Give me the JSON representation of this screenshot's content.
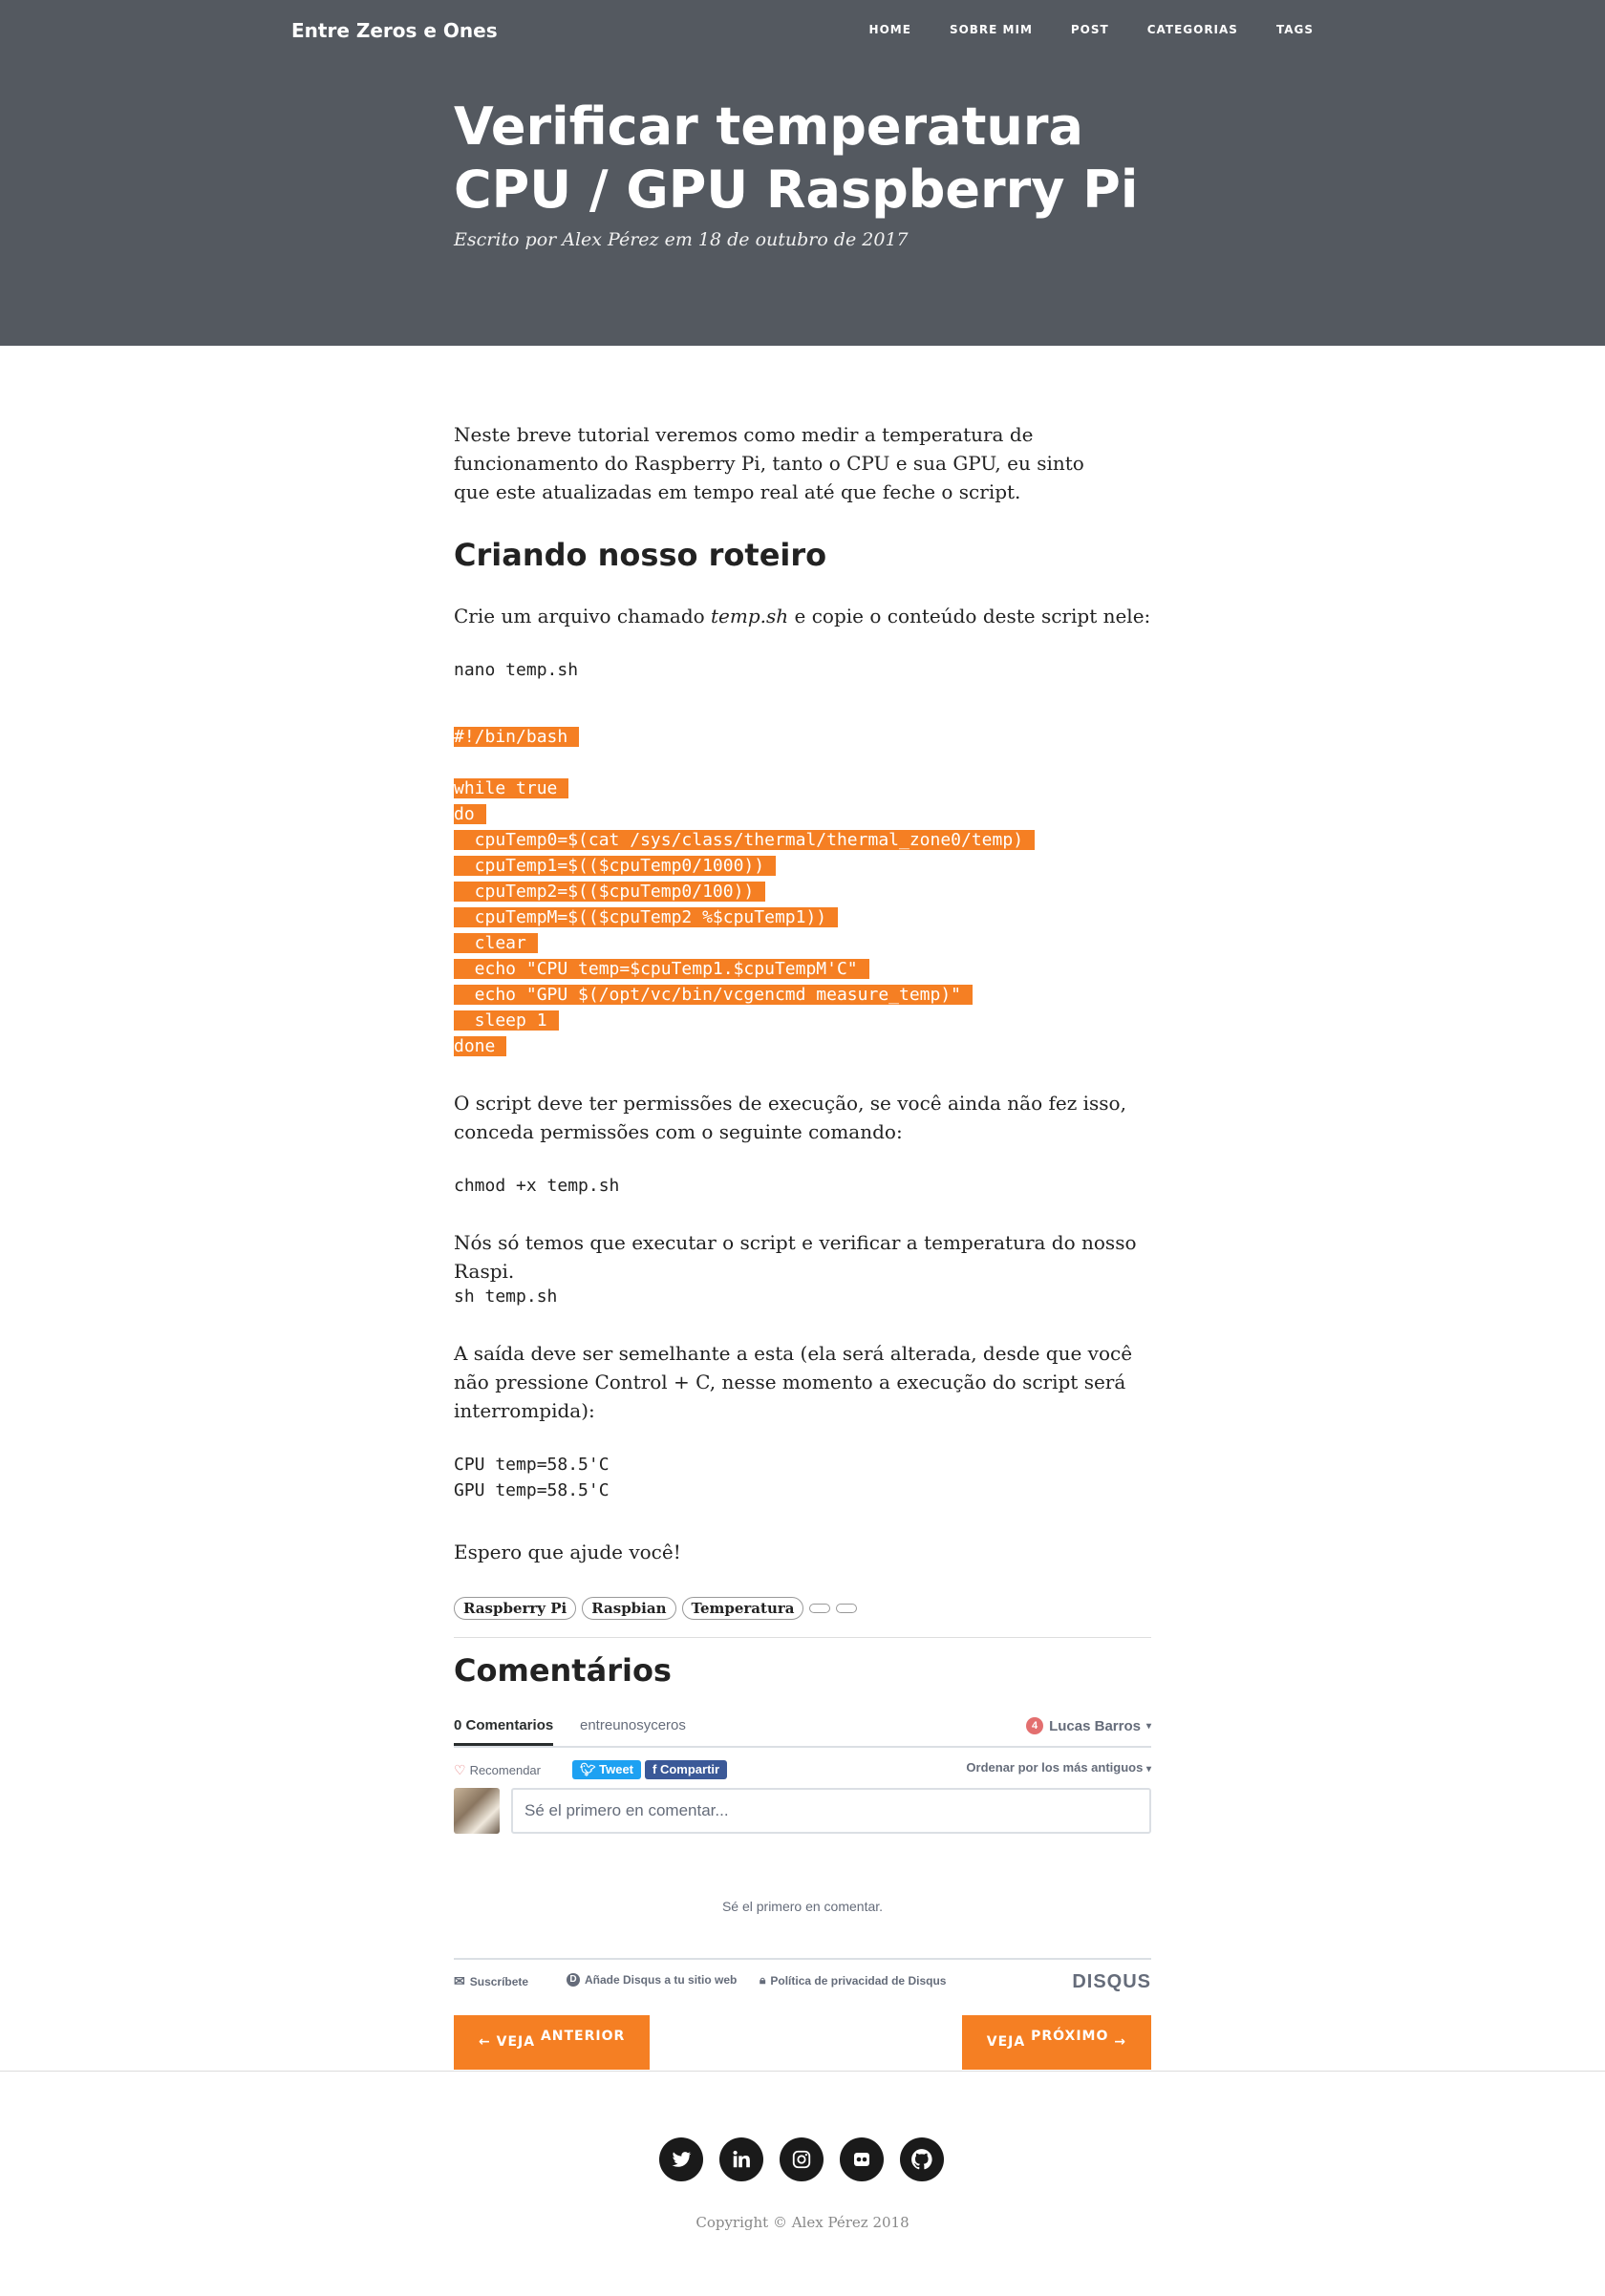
{
  "header": {
    "brand": "Entre Zeros e Ones",
    "nav": [
      "HOME",
      "SOBRE MIM",
      "POST",
      "CATEGORIAS",
      "TAGS"
    ],
    "title": "Verificar temperatura CPU / GPU Raspberry Pi",
    "byline": "Escrito por Alex Pérez em 18 de outubro de 2017",
    "bg_color": "#545960"
  },
  "article": {
    "intro": "Neste breve tutorial veremos como medir a temperatura de funcionamento do Raspberry Pi, tanto o CPU e sua GPU, eu sinto que este atualizadas em tempo real até que feche o script.",
    "heading": "Criando nosso roteiro",
    "create_before": "Crie um arquivo chamado ",
    "create_file": "temp.sh",
    "create_after": " e copie o conteúdo deste script nele:",
    "cmd_nano": "nano temp.sh",
    "script_lines": [
      "#!/bin/bash",
      "",
      "while true",
      "do",
      "  cpuTemp0=$(cat /sys/class/thermal/thermal_zone0/temp)",
      "  cpuTemp1=$(($cpuTemp0/1000))",
      "  cpuTemp2=$(($cpuTemp0/100))",
      "  cpuTempM=$(($cpuTemp2 %$cpuTemp1))",
      "  clear",
      "  echo \"CPU temp=$cpuTemp1.$cpuTempM'C\"",
      "  echo \"GPU $(/opt/vc/bin/vcgencmd measure_temp)\"",
      "  sleep 1",
      "done"
    ],
    "highlight_color": "#f57f23",
    "permissions_text": "O script deve ter permissões de execução, se você ainda não fez isso, conceda permissões com o seguinte comando:",
    "cmd_chmod": "chmod +x temp.sh",
    "run_text": "Nós só temos que executar o script e verificar a temperatura do nosso Raspi.",
    "cmd_run": "sh temp.sh",
    "output_text": "A saída deve ser semelhante a esta (ela será alterada, desde que você não pressione Control + C, nesse momento a execução do script será interrompida):",
    "output_lines": [
      "CPU temp=58.5'C",
      "GPU temp=58.5'C"
    ],
    "closing": "Espero que ajude você!",
    "tags": [
      "Raspberry Pi",
      "Raspbian",
      "Temperatura"
    ]
  },
  "comments": {
    "heading": "Comentários",
    "tab_comments": "0 Comentarios",
    "tab_site": "entreunosyceros",
    "badge_count": "4",
    "user": "Lucas Barros",
    "recommend": "Recomendar",
    "tweet": "Tweet",
    "share": "Compartir",
    "sort": "Ordenar por los más antiguos",
    "placeholder": "Sé el primero en comentar...",
    "empty": "Sé el primero en comentar.",
    "footer_subscribe": "Suscríbete",
    "footer_add": "Añade Disqus a tu sitio web",
    "footer_privacy": "Política de privacidad de Disqus",
    "logo": "DISQUS"
  },
  "pager": {
    "prev_arrow": "←",
    "prev_small": "VEJA",
    "prev_big": "ANTERIOR",
    "next_small": "VEJA",
    "next_big": "PRÓXIMO",
    "next_arrow": "→",
    "color": "#f57f23"
  },
  "footer": {
    "social_icons": [
      "twitter-icon",
      "linkedin-icon",
      "instagram-icon",
      "flickr-icon",
      "github-icon"
    ],
    "copyright": "Copyright © Alex Pérez 2018"
  }
}
